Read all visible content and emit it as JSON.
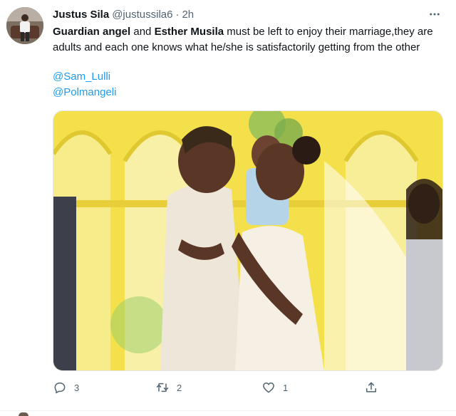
{
  "tweet": {
    "author": {
      "name": "Justus Sila",
      "handle": "@justussila6",
      "separator": "·",
      "time": "2h"
    },
    "text": {
      "bold1": "Guardian angel",
      "plain1": " and ",
      "bold2": "Esther Musila",
      "plain2": " must be left to enjoy their marriage,they are adults and each one knows what he/she is satisfactorily getting from the other"
    },
    "mentions": [
      "@Sam_Lulli",
      "@Polmangeli"
    ],
    "metrics": {
      "replies": "3",
      "retweets": "2",
      "likes": "1"
    },
    "icons": {
      "more": "more-dots-icon",
      "reply": "reply-icon",
      "retweet": "retweet-icon",
      "like": "heart-icon",
      "share": "share-icon"
    }
  },
  "colors": {
    "link": "#1d9bf0",
    "text": "#0f1419",
    "secondary": "#536471",
    "photo_background": "#f3e04a"
  }
}
